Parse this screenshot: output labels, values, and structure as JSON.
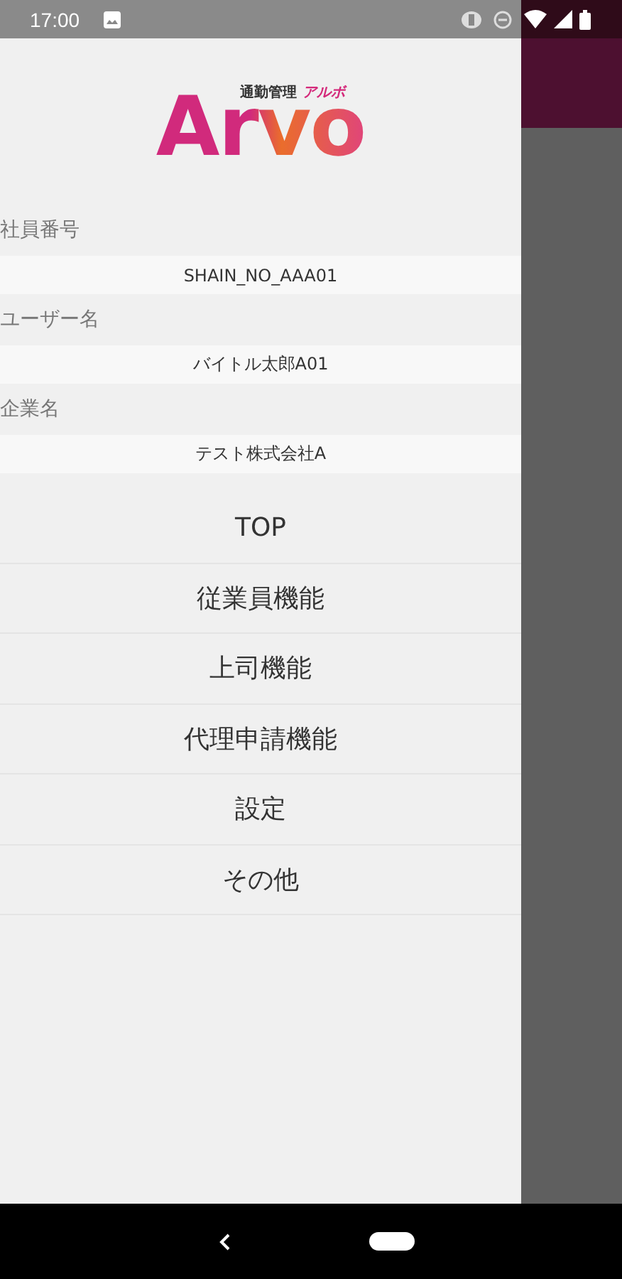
{
  "status_bar": {
    "time": "17:00"
  },
  "logo": {
    "name": "Arvo",
    "tagline": "通勤管理",
    "kana": "アルボ"
  },
  "profile": [
    {
      "label": "社員番号",
      "value": "SHAIN_NO_AAA01"
    },
    {
      "label": "ユーザー名",
      "value": "バイトル太郎A01"
    },
    {
      "label": "企業名",
      "value": "テスト株式会社A"
    }
  ],
  "menu": [
    {
      "label": "TOP"
    },
    {
      "label": "従業員機能"
    },
    {
      "label": "上司機能"
    },
    {
      "label": "代理申請機能"
    },
    {
      "label": "設定"
    },
    {
      "label": "その他"
    }
  ]
}
